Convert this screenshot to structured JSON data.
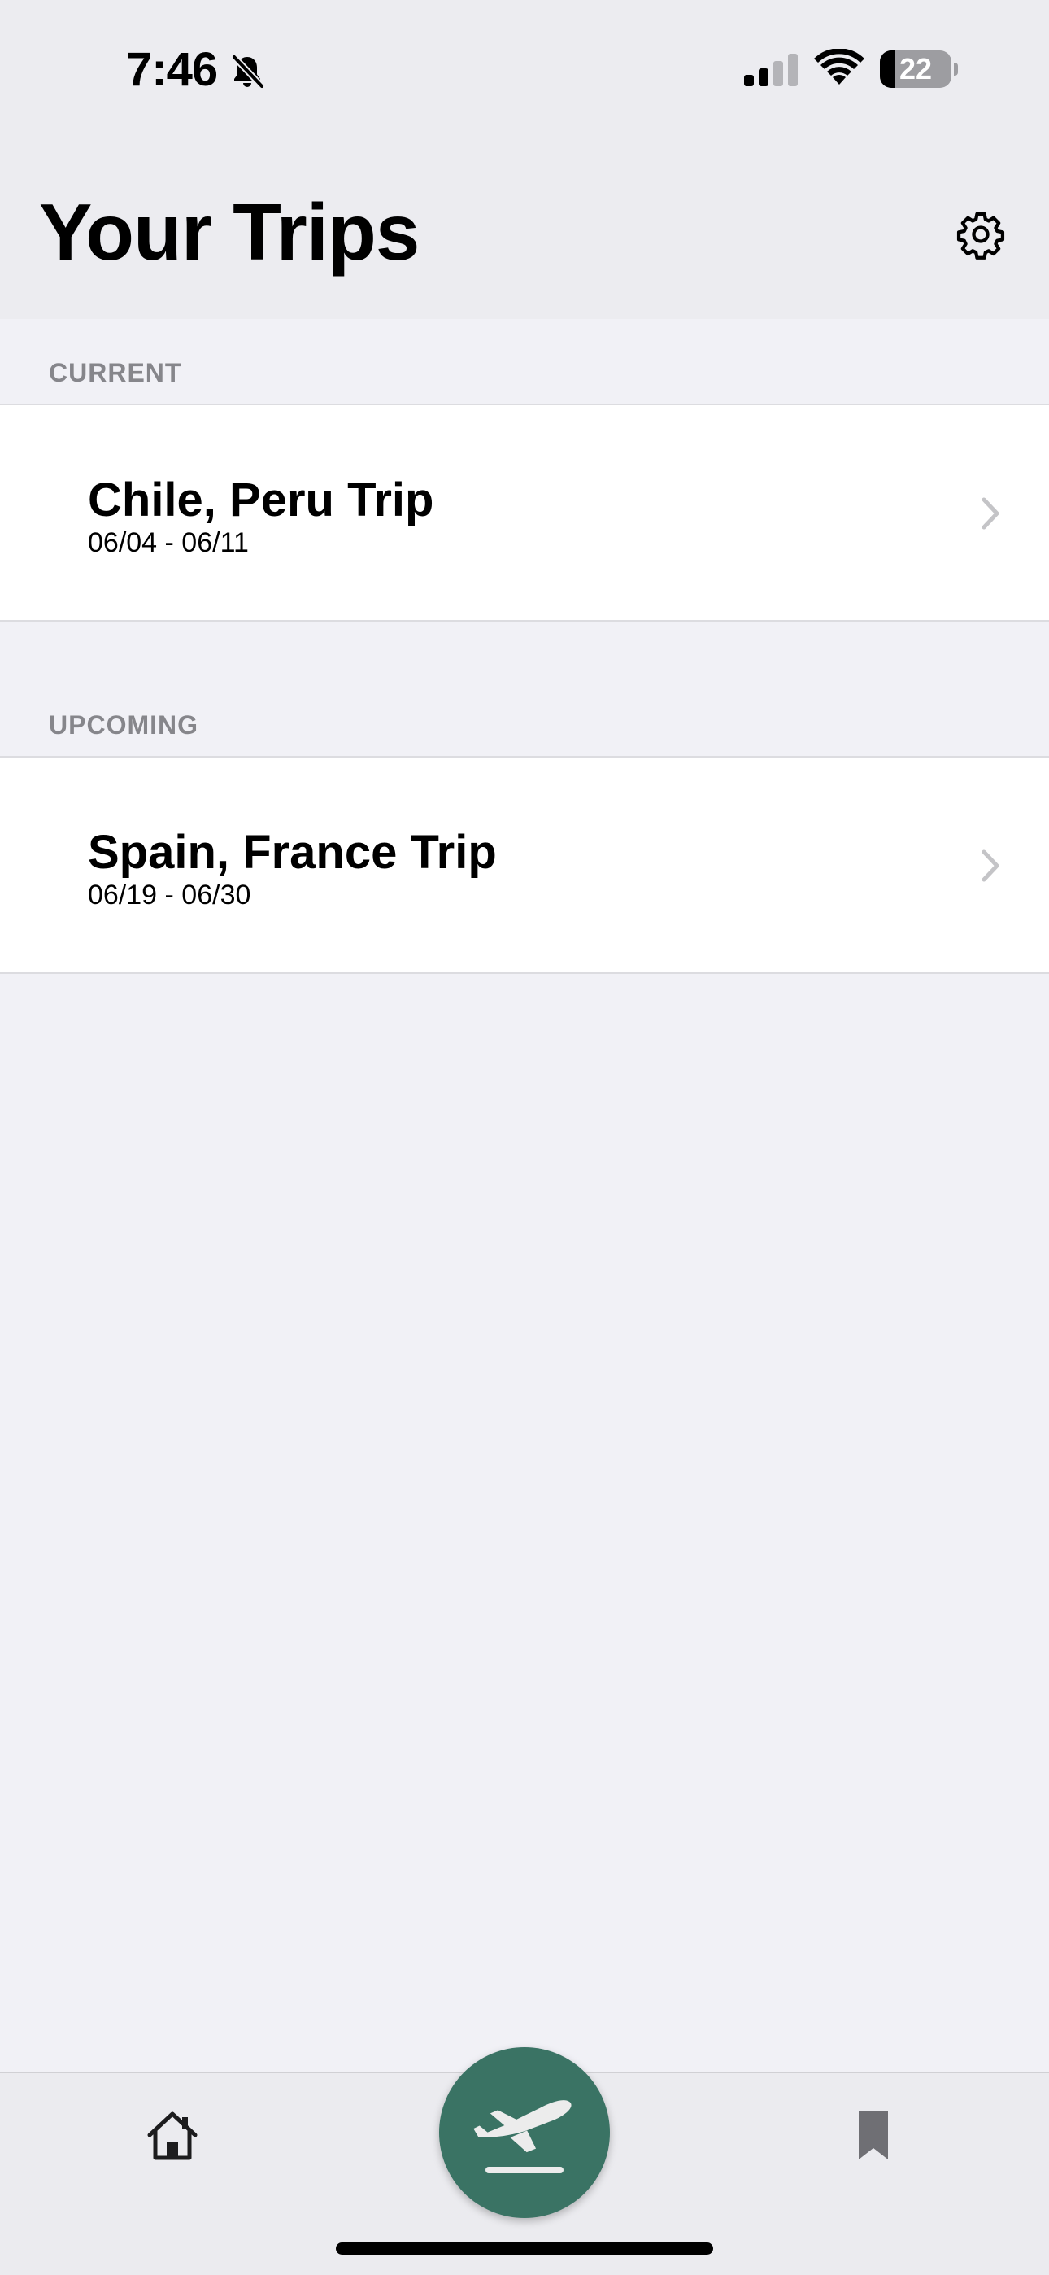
{
  "status_bar": {
    "time": "7:46",
    "battery_level": "22",
    "battery_fraction": 0.22,
    "icons": [
      "bell-slash-icon",
      "cellular-signal-icon",
      "wifi-icon",
      "battery-icon"
    ]
  },
  "header": {
    "title": "Your Trips",
    "settings_icon": "gear-icon"
  },
  "sections": [
    {
      "header": "CURRENT",
      "trips": [
        {
          "name": "Chile, Peru Trip",
          "dates": "06/04 - 06/11"
        }
      ]
    },
    {
      "header": "UPCOMING",
      "trips": [
        {
          "name": "Spain, France Trip",
          "dates": "06/19 - 06/30"
        }
      ]
    }
  ],
  "tab_bar": {
    "items": [
      {
        "icon": "house-icon"
      },
      {
        "icon": "airplane-departure-icon"
      },
      {
        "icon": "bookmark-icon"
      }
    ]
  },
  "colors": {
    "accent": "#3a7364",
    "background": "#f1f1f6",
    "header_background": "#ececf0",
    "cell_background": "#ffffff",
    "section_header_text": "#86868b",
    "chevron": "#c4c4c7"
  }
}
